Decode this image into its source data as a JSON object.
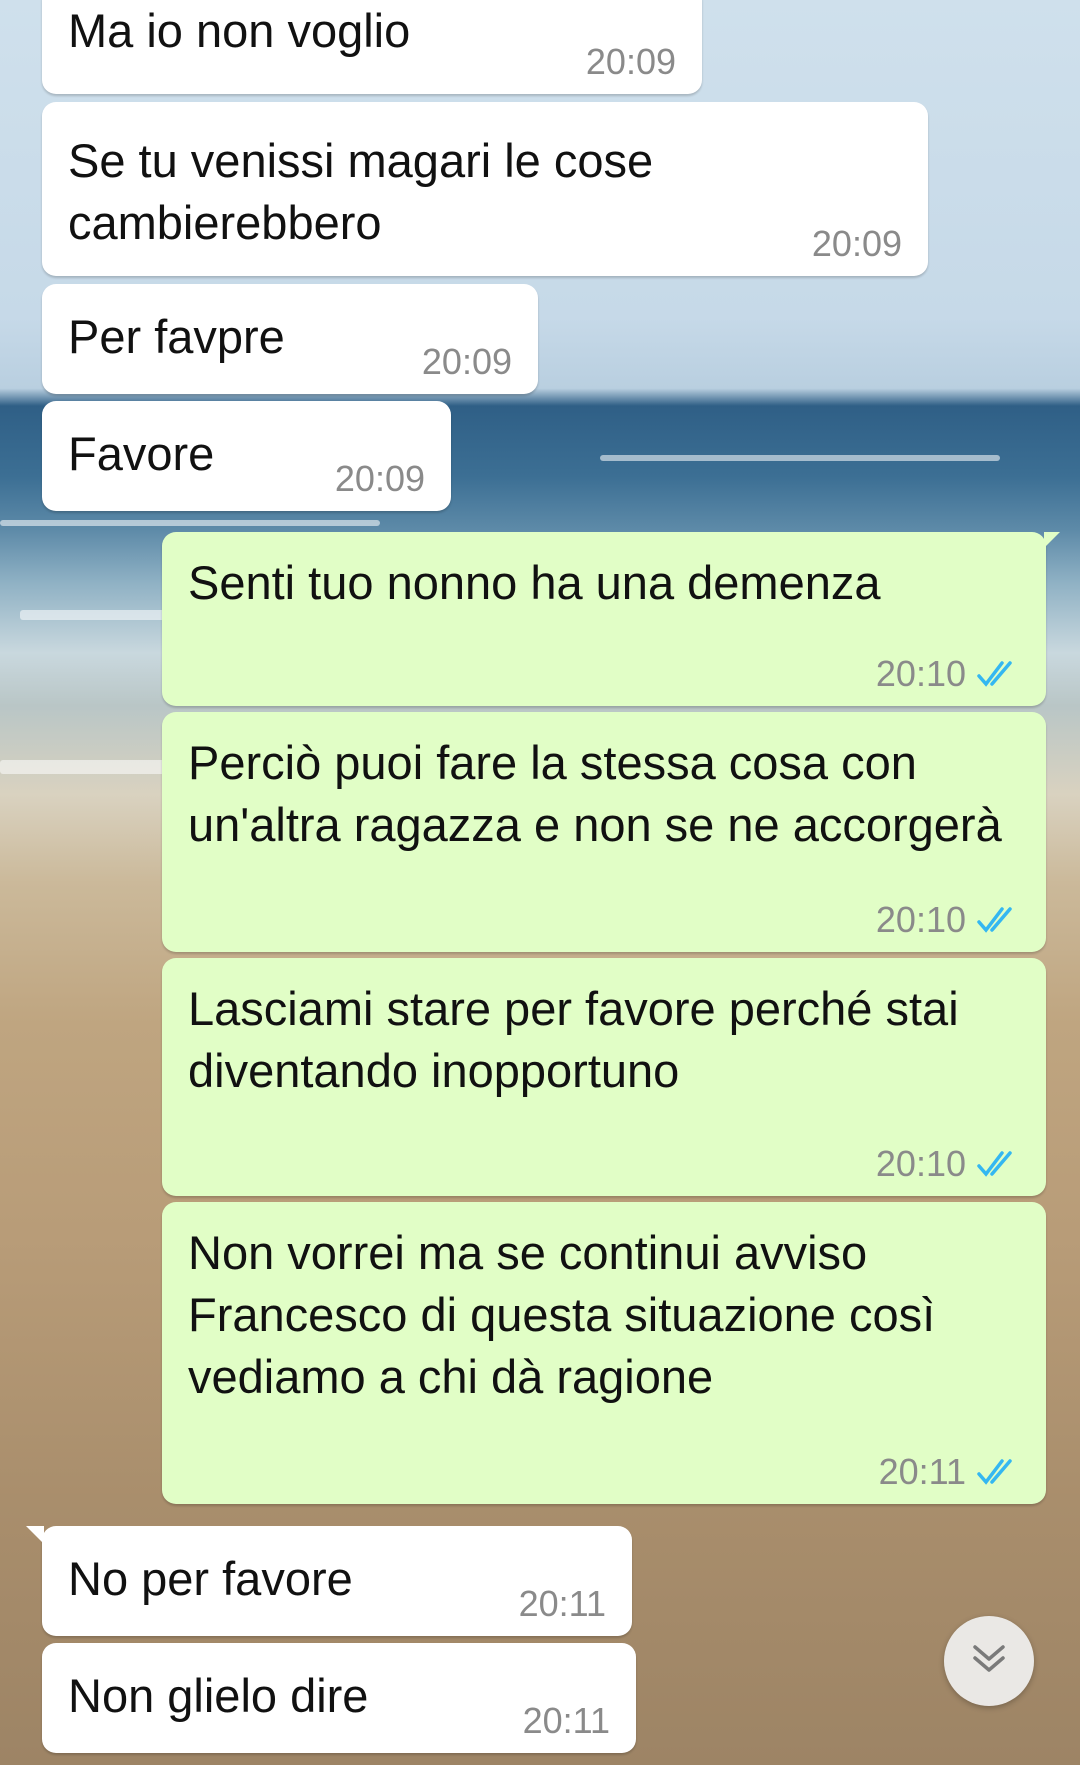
{
  "chat": {
    "messages": [
      {
        "text": "Ma io non voglio",
        "time": "20:09",
        "direction": "incoming"
      },
      {
        "text": "Se tu venissi magari le cose cambierebbero",
        "time": "20:09",
        "direction": "incoming"
      },
      {
        "text": "Per favpre",
        "time": "20:09",
        "direction": "incoming"
      },
      {
        "text": "Favore",
        "time": "20:09",
        "direction": "incoming"
      },
      {
        "text": "Senti tuo nonno ha una demenza",
        "time": "20:10",
        "direction": "outgoing",
        "status": "read"
      },
      {
        "text": "Perciò puoi fare la stessa cosa con un'altra ragazza e non se ne accorgerà",
        "time": "20:10",
        "direction": "outgoing",
        "status": "read"
      },
      {
        "text": "Lasciami stare per favore perché stai diventando inopportuno",
        "time": "20:10",
        "direction": "outgoing",
        "status": "read"
      },
      {
        "text": "Non vorrei ma se continui avviso Francesco di questa situazione così vediamo a chi dà ragione",
        "time": "20:11",
        "direction": "outgoing",
        "status": "read"
      },
      {
        "text": "No per favore",
        "time": "20:11",
        "direction": "incoming"
      },
      {
        "text": "Non glielo dire",
        "time": "20:11",
        "direction": "incoming"
      }
    ]
  },
  "icons": {
    "read_receipt": "double-check-icon",
    "scroll_down": "double-chevron-down-icon"
  },
  "colors": {
    "incoming_bubble": "#ffffff",
    "outgoing_bubble": "#e1fec6",
    "read_tick": "#34b7f1",
    "timestamp": "#8a8a8a"
  }
}
